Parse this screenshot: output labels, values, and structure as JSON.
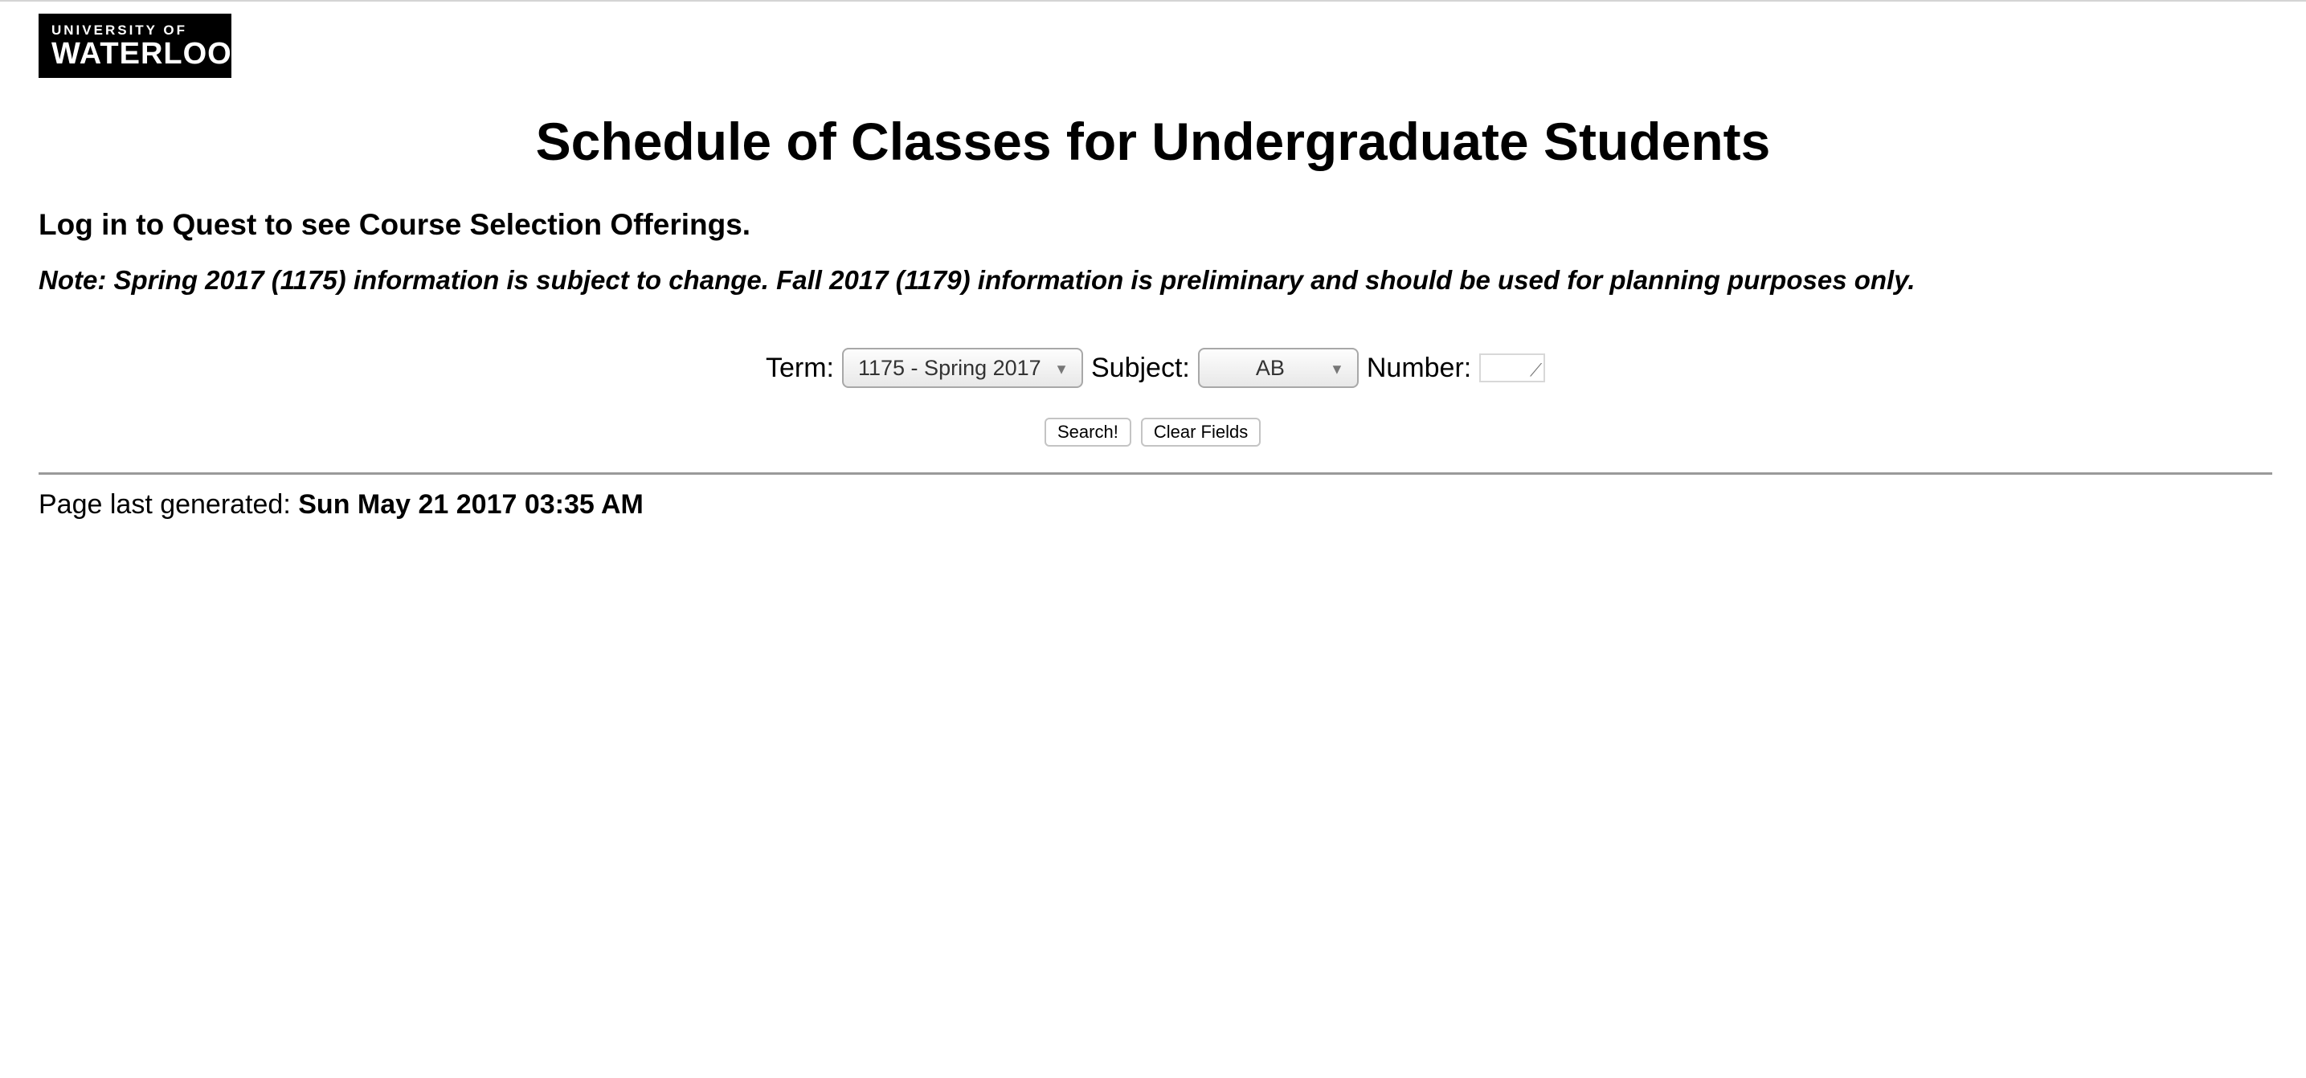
{
  "logo": {
    "line1": "UNIVERSITY OF",
    "line2": "WATERLOO"
  },
  "page_title": "Schedule of Classes for Undergraduate Students",
  "login_message": "Log in to Quest to see Course Selection Offerings.",
  "note": "Note: Spring 2017 (1175) information is subject to change. Fall 2017 (1179) information is preliminary and should be used for planning purposes only.",
  "form": {
    "term_label": "Term:",
    "term_value": "1175 - Spring 2017",
    "subject_label": "Subject:",
    "subject_value": "AB",
    "number_label": "Number:",
    "number_value": "",
    "search_button": "Search!",
    "clear_button": "Clear Fields"
  },
  "footer": {
    "generated_label": "Page last generated:",
    "generated_value": "Sun May 21 2017 03:35 AM"
  }
}
